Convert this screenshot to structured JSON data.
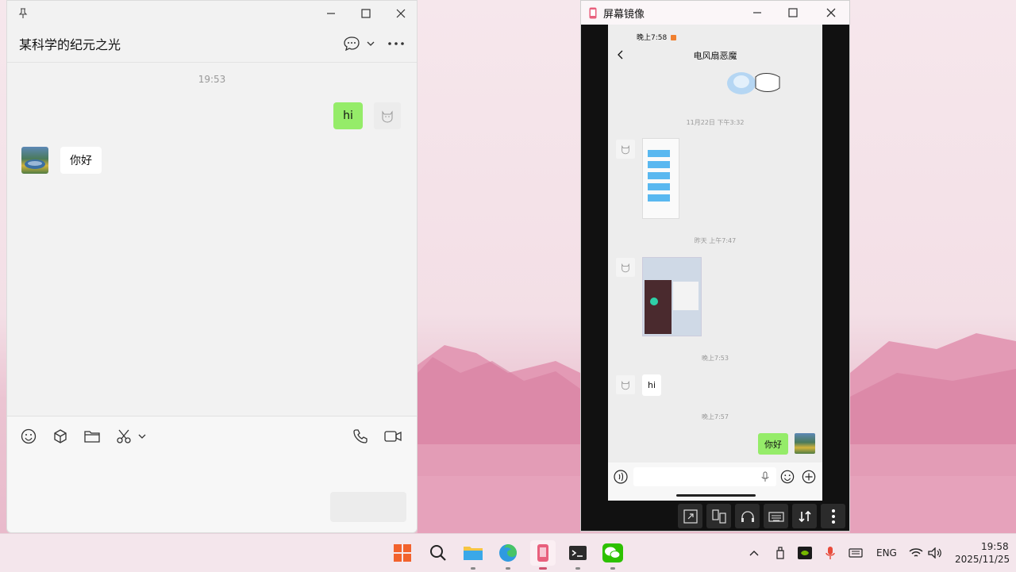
{
  "chat_window": {
    "title": "某科学的纪元之光",
    "messages_time": "19:53",
    "messages": [
      {
        "side": "right",
        "text": "hi"
      },
      {
        "side": "left",
        "text": "你好"
      }
    ],
    "icons": {
      "pin": "pin-icon",
      "minimize": "minimize-icon",
      "maximize": "maximize-icon",
      "close": "close-icon",
      "chat_menu": "chat-bubble-icon",
      "more": "more-icon",
      "emoji": "emoji-icon",
      "sticker": "cube-icon",
      "folder": "folder-icon",
      "scissors": "scissors-icon",
      "call": "phone-icon",
      "video": "video-icon"
    }
  },
  "mirror_window": {
    "title": "屏幕镜像",
    "phone": {
      "status_time": "晚上7:58",
      "chat_title": "电风扇恶魔",
      "timestamps": [
        "11月22日 下午3:32",
        "昨天 上午7:47",
        "晚上7:53",
        "晚上7:57"
      ],
      "received_text": "hi",
      "sent_text": "你好"
    }
  },
  "taskbar": {
    "language": "ENG",
    "time": "19:58",
    "date": "2025/11/25"
  }
}
